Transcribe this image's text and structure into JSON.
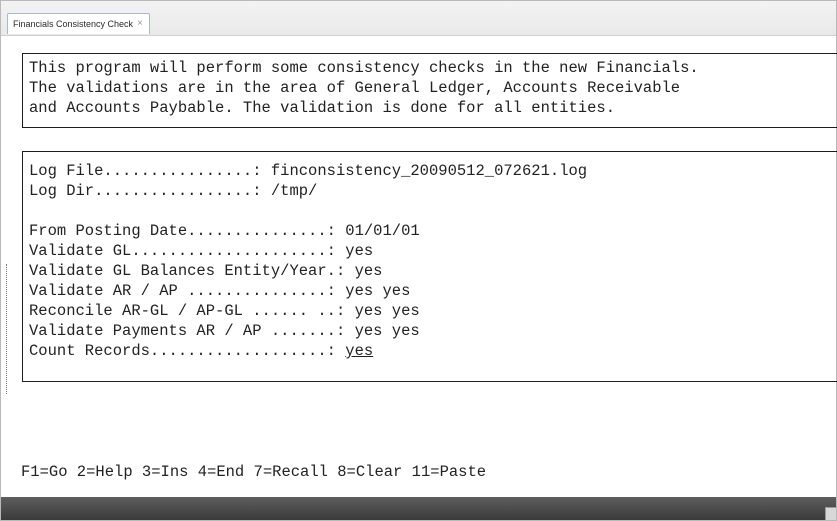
{
  "tab": {
    "label": "Financials Consistency Check",
    "close": "×"
  },
  "intro": {
    "line1": "This program will perform some consistency checks in the new Financials.",
    "line2": "The validations are in the area of General Ledger, Accounts Receivable",
    "line3": "and Accounts Paybable. The validation is done for all entities."
  },
  "log": {
    "file_label": "Log File................: ",
    "file_value": "finconsistency_20090512_072621.log",
    "dir_label": "Log Dir.................: ",
    "dir_value": "/tmp/"
  },
  "settings": [
    {
      "label": "From Posting Date...............: ",
      "value": "01/01/01"
    },
    {
      "label": "Validate GL.....................: ",
      "value": "yes"
    },
    {
      "label": "Validate GL Balances Entity/Year.: ",
      "value": "yes"
    },
    {
      "label": "Validate AR / AP ...............: ",
      "value": "yes yes"
    },
    {
      "label": "Reconcile AR-GL / AP-GL ...... ..: ",
      "value": "yes yes"
    },
    {
      "label": "Validate Payments AR / AP .......: ",
      "value": "yes yes"
    },
    {
      "label": "Count Records...................: ",
      "value": "yes"
    }
  ],
  "function_keys": "F1=Go 2=Help 3=Ins 4=End 7=Recall 8=Clear 11=Paste"
}
